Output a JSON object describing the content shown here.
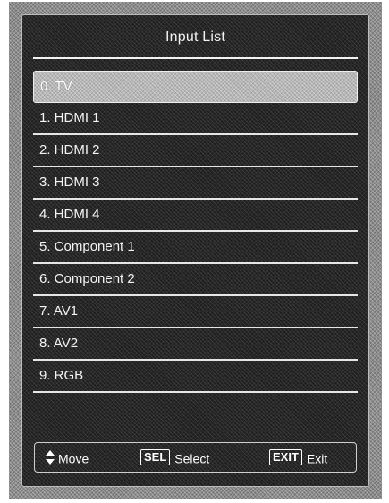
{
  "menu": {
    "title": "Input List",
    "selected_index": 0,
    "items": [
      {
        "label": "0. TV"
      },
      {
        "label": "1. HDMI 1"
      },
      {
        "label": "2. HDMI 2"
      },
      {
        "label": "3. HDMI 3"
      },
      {
        "label": "4. HDMI 4"
      },
      {
        "label": "5. Component 1"
      },
      {
        "label": "6. Component 2"
      },
      {
        "label": "7. AV1"
      },
      {
        "label": "8. AV2"
      },
      {
        "label": "9. RGB"
      }
    ]
  },
  "footer": {
    "move": {
      "icon": "up-down-arrows-icon",
      "label": "Move"
    },
    "select": {
      "key": "SEL",
      "label": "Select"
    },
    "exit": {
      "key": "EXIT",
      "label": "Exit"
    }
  },
  "colors": {
    "panel_background": "#1e1e1e",
    "frame": "#8c8c8c",
    "highlight": "#b6b6b6",
    "text": "#f4f4f4"
  }
}
